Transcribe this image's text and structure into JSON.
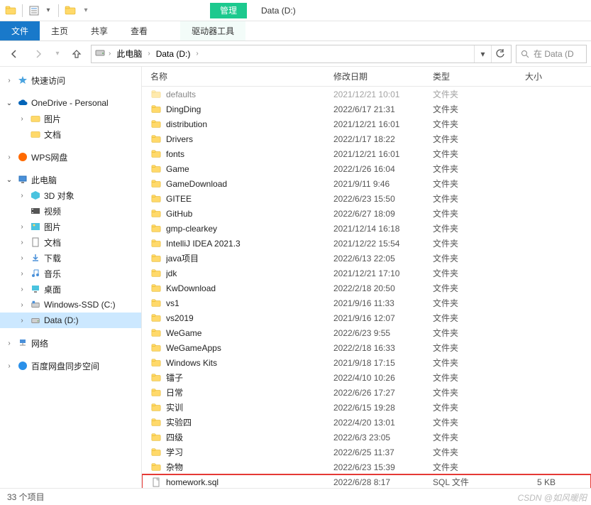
{
  "window": {
    "title": "Data (D:)",
    "context_tab": "管理",
    "context_tool": "驱动器工具"
  },
  "ribbon": {
    "file": "文件",
    "home": "主页",
    "share": "共享",
    "view": "查看"
  },
  "address": {
    "root": "此电脑",
    "current": "Data (D:)",
    "search_placeholder": "在 Data (D"
  },
  "sidebar": {
    "quick_access": "快速访问",
    "onedrive": "OneDrive - Personal",
    "pictures": "图片",
    "documents": "文档",
    "wps": "WPS网盘",
    "this_pc": "此电脑",
    "objects3d": "3D 对象",
    "videos": "视频",
    "pictures2": "图片",
    "documents2": "文档",
    "downloads": "下载",
    "music": "音乐",
    "desktop": "桌面",
    "windows_ssd": "Windows-SSD (C:)",
    "data_d": "Data (D:)",
    "network": "网络",
    "baidu": "百度网盘同步空间"
  },
  "columns": {
    "name": "名称",
    "date": "修改日期",
    "type": "类型",
    "size": "大小"
  },
  "files": [
    {
      "name": "defaults",
      "date": "2021/12/21 10:01",
      "type": "文件夹",
      "size": "",
      "icon": "folder",
      "partial": true
    },
    {
      "name": "DingDing",
      "date": "2022/6/17 21:31",
      "type": "文件夹",
      "size": "",
      "icon": "folder"
    },
    {
      "name": "distribution",
      "date": "2021/12/21 16:01",
      "type": "文件夹",
      "size": "",
      "icon": "folder"
    },
    {
      "name": "Drivers",
      "date": "2022/1/17 18:22",
      "type": "文件夹",
      "size": "",
      "icon": "folder"
    },
    {
      "name": "fonts",
      "date": "2021/12/21 16:01",
      "type": "文件夹",
      "size": "",
      "icon": "folder"
    },
    {
      "name": "Game",
      "date": "2022/1/26 16:04",
      "type": "文件夹",
      "size": "",
      "icon": "folder"
    },
    {
      "name": "GameDownload",
      "date": "2021/9/11 9:46",
      "type": "文件夹",
      "size": "",
      "icon": "folder"
    },
    {
      "name": "GITEE",
      "date": "2022/6/23 15:50",
      "type": "文件夹",
      "size": "",
      "icon": "folder"
    },
    {
      "name": "GitHub",
      "date": "2022/6/27 18:09",
      "type": "文件夹",
      "size": "",
      "icon": "folder"
    },
    {
      "name": "gmp-clearkey",
      "date": "2021/12/14 16:18",
      "type": "文件夹",
      "size": "",
      "icon": "folder"
    },
    {
      "name": "IntelliJ IDEA 2021.3",
      "date": "2021/12/22 15:54",
      "type": "文件夹",
      "size": "",
      "icon": "folder"
    },
    {
      "name": "java项目",
      "date": "2022/6/13 22:05",
      "type": "文件夹",
      "size": "",
      "icon": "folder"
    },
    {
      "name": "jdk",
      "date": "2021/12/21 17:10",
      "type": "文件夹",
      "size": "",
      "icon": "folder"
    },
    {
      "name": "KwDownload",
      "date": "2022/2/18 20:50",
      "type": "文件夹",
      "size": "",
      "icon": "folder"
    },
    {
      "name": "vs1",
      "date": "2021/9/16 11:33",
      "type": "文件夹",
      "size": "",
      "icon": "folder"
    },
    {
      "name": "vs2019",
      "date": "2021/9/16 12:07",
      "type": "文件夹",
      "size": "",
      "icon": "folder"
    },
    {
      "name": "WeGame",
      "date": "2022/6/23 9:55",
      "type": "文件夹",
      "size": "",
      "icon": "folder"
    },
    {
      "name": "WeGameApps",
      "date": "2022/2/18 16:33",
      "type": "文件夹",
      "size": "",
      "icon": "folder"
    },
    {
      "name": "Windows Kits",
      "date": "2021/9/18 17:15",
      "type": "文件夹",
      "size": "",
      "icon": "folder"
    },
    {
      "name": "镭子",
      "date": "2022/4/10 10:26",
      "type": "文件夹",
      "size": "",
      "icon": "folder"
    },
    {
      "name": "日常",
      "date": "2022/6/26 17:27",
      "type": "文件夹",
      "size": "",
      "icon": "folder"
    },
    {
      "name": "实训",
      "date": "2022/6/15 19:28",
      "type": "文件夹",
      "size": "",
      "icon": "folder"
    },
    {
      "name": "实验四",
      "date": "2022/4/20 13:01",
      "type": "文件夹",
      "size": "",
      "icon": "folder"
    },
    {
      "name": "四级",
      "date": "2022/6/3 23:05",
      "type": "文件夹",
      "size": "",
      "icon": "folder"
    },
    {
      "name": "学习",
      "date": "2022/6/25 11:37",
      "type": "文件夹",
      "size": "",
      "icon": "folder"
    },
    {
      "name": "杂物",
      "date": "2022/6/23 15:39",
      "type": "文件夹",
      "size": "",
      "icon": "folder"
    },
    {
      "name": "homework.sql",
      "date": "2022/6/28 8:17",
      "type": "SQL 文件",
      "size": "5 KB",
      "icon": "file",
      "highlighted": true
    }
  ],
  "status": {
    "count": "33 个项目"
  },
  "watermark": "CSDN @如风暖阳",
  "search_icon_label": "搜索"
}
